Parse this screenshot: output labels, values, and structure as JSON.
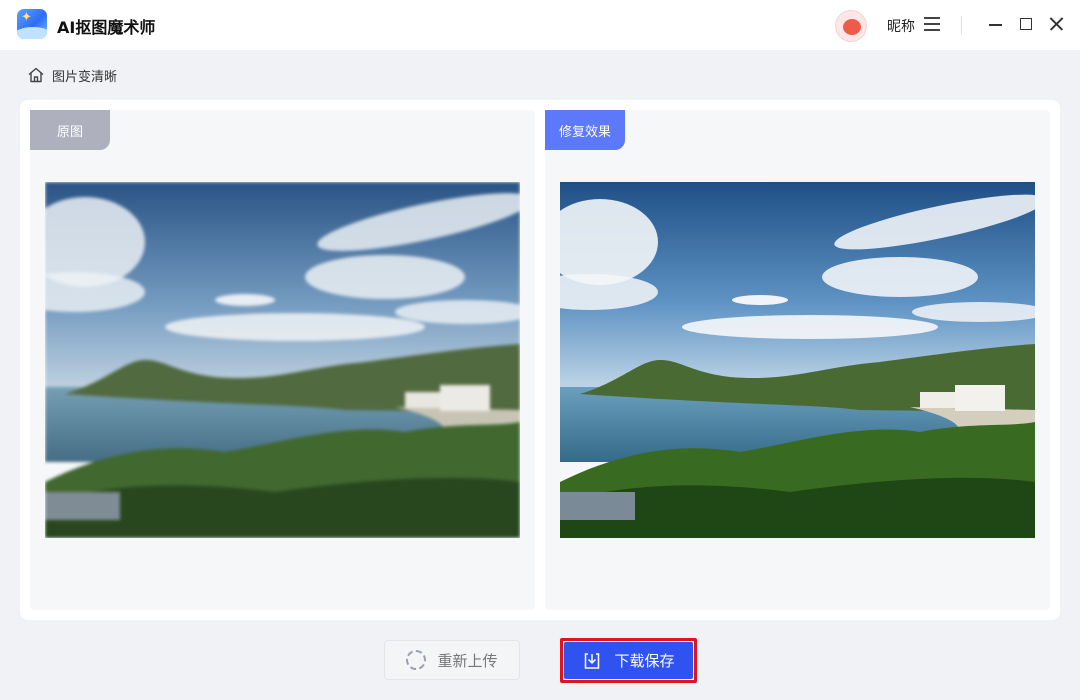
{
  "app": {
    "title": "AI抠图魔术师",
    "logo_icon": "app-logo-icon"
  },
  "user": {
    "nickname": "昵称",
    "avatar_icon": "red-bird-avatar"
  },
  "window_controls": [
    "menu-icon",
    "minimize-icon",
    "maximize-icon",
    "close-icon"
  ],
  "breadcrumb": {
    "icon": "home-icon",
    "label": "图片变清晰"
  },
  "panels": {
    "original": {
      "tag": "原图",
      "image_state": "blurry"
    },
    "result": {
      "tag": "修复效果",
      "image_state": "sharp"
    }
  },
  "actions": {
    "reupload_label": "重新上传",
    "download_label": "下载保存"
  },
  "colors": {
    "accent": "#2f52f0",
    "result_tag": "#5b79f9",
    "original_tag": "#aeb1bd",
    "highlight_border": "#e2141b"
  }
}
